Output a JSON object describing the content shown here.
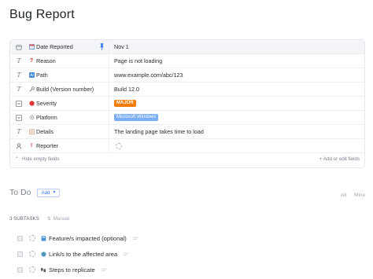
{
  "page": {
    "title": "Bug Report"
  },
  "fields": [
    {
      "type_icon": "calendar-icon",
      "emoji": "calendar-icon",
      "label": "Date Reported",
      "value": "Nov 1",
      "pinned": true
    },
    {
      "type_icon": "text-type-icon",
      "emoji": "question-mark-icon",
      "label": "Reason",
      "value": "Page is not loading"
    },
    {
      "type_icon": "text-type-icon",
      "emoji": "path-icon",
      "label": "Path",
      "value": "www.example.com/abc/123"
    },
    {
      "type_icon": "text-type-icon",
      "emoji": "wrench-icon",
      "label": "Build (Version number)",
      "value": "Build 12.0"
    },
    {
      "type_icon": "dropdown-type-icon",
      "emoji": "red-circle-icon",
      "label": "Severity",
      "value": "MAJOR",
      "value_color": "#f57c00"
    },
    {
      "type_icon": "dropdown-type-icon",
      "emoji": "gear-icon",
      "label": "Platform",
      "value": "Microsoft Windows",
      "value_color": "#7aaef5"
    },
    {
      "type_icon": "text-type-icon",
      "emoji": "notepad-icon",
      "label": "Details",
      "value": "The landing page takes time to load"
    },
    {
      "type_icon": "person-type-icon",
      "emoji": "exclamation-icon",
      "label": "Reporter",
      "value": ""
    }
  ],
  "fields_footer": {
    "hide_empty": "Hide empty fields",
    "add_or_edit": "+ Add or edit fields"
  },
  "todo": {
    "title": "To Do",
    "add_label": "Add",
    "filters": [
      "All",
      "Mine"
    ],
    "subtask_count": "3 SUBTASKS",
    "sort_label": "Manual",
    "subtasks": [
      {
        "emoji": "blue-book-icon",
        "label": "Feature/s impacted (optional)"
      },
      {
        "emoji": "globe-icon",
        "label": "Link/s to the affected area"
      },
      {
        "emoji": "footprints-icon",
        "label": "Steps to replicate"
      }
    ]
  },
  "colors": {
    "accent": "#3d78f5",
    "major": "#f57c00",
    "platform": "#7aaef5"
  }
}
